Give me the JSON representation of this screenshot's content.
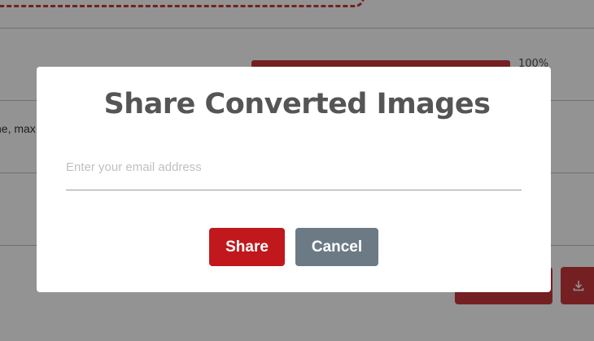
{
  "background": {
    "progress": {
      "value_percent": 100,
      "label": "100%"
    },
    "row_text": "ne, max",
    "download_icon": "download-icon",
    "accent_color": "#c0181d"
  },
  "modal": {
    "title": "Share Converted Images",
    "email": {
      "value": "",
      "placeholder": "Enter your email address"
    },
    "share_label": "Share",
    "cancel_label": "Cancel",
    "share_color": "#c0181d",
    "cancel_color": "#6c7a86"
  }
}
